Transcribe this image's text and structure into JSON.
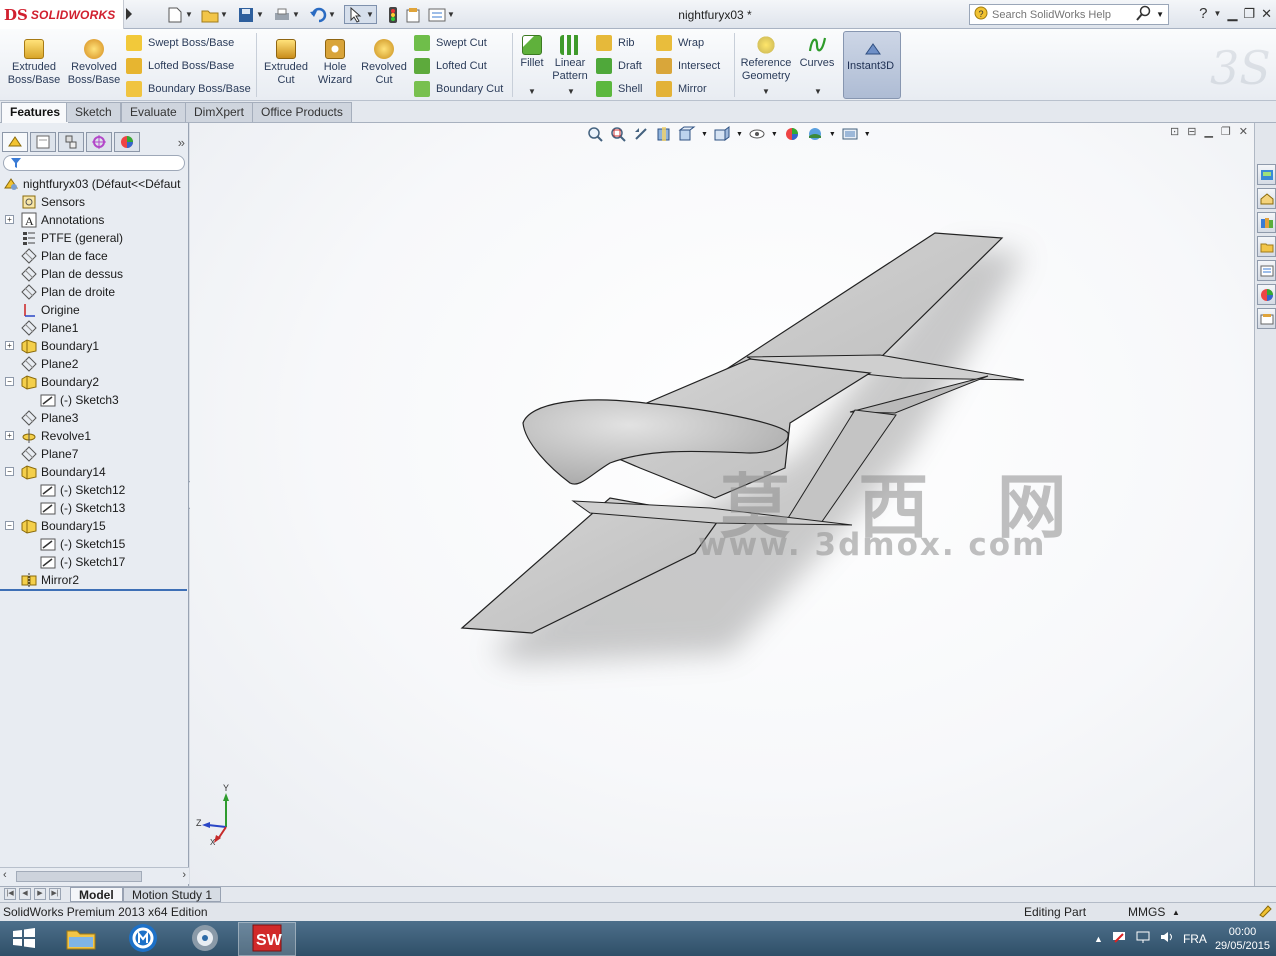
{
  "app": {
    "brand_mark": "DS",
    "brand_name": "SOLIDWORKS",
    "document_title": "nightfuryx03 *"
  },
  "search": {
    "placeholder": "Search SolidWorks Help"
  },
  "ribbon": {
    "extruded_boss": [
      "Extruded",
      "Boss/Base"
    ],
    "revolved_boss": [
      "Revolved",
      "Boss/Base"
    ],
    "swept_boss": "Swept Boss/Base",
    "lofted_boss": "Lofted Boss/Base",
    "boundary_boss": "Boundary Boss/Base",
    "extruded_cut": [
      "Extruded",
      "Cut"
    ],
    "hole_wizard": [
      "Hole",
      "Wizard"
    ],
    "revolved_cut": [
      "Revolved",
      "Cut"
    ],
    "swept_cut": "Swept Cut",
    "lofted_cut": "Lofted Cut",
    "boundary_cut": "Boundary Cut",
    "fillet": "Fillet",
    "linear_pattern": [
      "Linear",
      "Pattern"
    ],
    "rib": "Rib",
    "draft": "Draft",
    "shell": "Shell",
    "wrap": "Wrap",
    "intersect": "Intersect",
    "mirror": "Mirror",
    "reference_geometry": [
      "Reference",
      "Geometry"
    ],
    "curves": "Curves",
    "instant3d": "Instant3D"
  },
  "tabs": [
    "Features",
    "Sketch",
    "Evaluate",
    "DimXpert",
    "Office Products"
  ],
  "feature_tree": [
    {
      "label": "nightfuryx03  (Défaut<<Défaut",
      "icon": "part-icon",
      "level": 0,
      "expander": ""
    },
    {
      "label": "Sensors",
      "icon": "sensor-icon",
      "level": 1,
      "expander": ""
    },
    {
      "label": "Annotations",
      "icon": "annotation-icon",
      "level": 1,
      "expander": "+"
    },
    {
      "label": "PTFE (general)",
      "icon": "material-icon",
      "level": 1,
      "expander": ""
    },
    {
      "label": "Plan de face",
      "icon": "plane-icon",
      "level": 1,
      "expander": ""
    },
    {
      "label": "Plan de dessus",
      "icon": "plane-icon",
      "level": 1,
      "expander": ""
    },
    {
      "label": "Plan de droite",
      "icon": "plane-icon",
      "level": 1,
      "expander": ""
    },
    {
      "label": "Origine",
      "icon": "origin-icon",
      "level": 1,
      "expander": ""
    },
    {
      "label": "Plane1",
      "icon": "plane-icon",
      "level": 1,
      "expander": ""
    },
    {
      "label": "Boundary1",
      "icon": "boundary-icon",
      "level": 1,
      "expander": "+"
    },
    {
      "label": "Plane2",
      "icon": "plane-icon",
      "level": 1,
      "expander": ""
    },
    {
      "label": "Boundary2",
      "icon": "boundary-icon",
      "level": 1,
      "expander": "-"
    },
    {
      "label": "(-) Sketch3",
      "icon": "sketch-icon",
      "level": 2,
      "expander": ""
    },
    {
      "label": "Plane3",
      "icon": "plane-icon",
      "level": 1,
      "expander": ""
    },
    {
      "label": "Revolve1",
      "icon": "revolve-icon",
      "level": 1,
      "expander": "+"
    },
    {
      "label": "Plane7",
      "icon": "plane-icon",
      "level": 1,
      "expander": ""
    },
    {
      "label": "Boundary14",
      "icon": "boundary-icon",
      "level": 1,
      "expander": "-"
    },
    {
      "label": "(-) Sketch12",
      "icon": "sketch-icon",
      "level": 2,
      "expander": ""
    },
    {
      "label": "(-) Sketch13",
      "icon": "sketch-icon",
      "level": 2,
      "expander": ""
    },
    {
      "label": "Boundary15",
      "icon": "boundary-icon",
      "level": 1,
      "expander": "-"
    },
    {
      "label": "(-) Sketch15",
      "icon": "sketch-icon",
      "level": 2,
      "expander": ""
    },
    {
      "label": "(-) Sketch17",
      "icon": "sketch-icon",
      "level": 2,
      "expander": ""
    },
    {
      "label": "Mirror2",
      "icon": "mirror-icon",
      "level": 1,
      "expander": ""
    }
  ],
  "watermark": {
    "chars": "莫 西 网",
    "url": "www. 3dmox. com"
  },
  "triad": {
    "x": "X",
    "y": "Y",
    "z": "Z"
  },
  "model_tabs": [
    "Model",
    "Motion Study 1"
  ],
  "status": {
    "edition": "SolidWorks Premium 2013 x64 Edition",
    "mode": "Editing Part",
    "units": "MMGS"
  },
  "taskbar": {
    "language": "FRA",
    "time": "00:00",
    "date": "29/05/2015"
  },
  "colors": {
    "brand_red": "#d1202f",
    "model_gray": "#c8c8c8",
    "taskbar": "#3f6079"
  }
}
